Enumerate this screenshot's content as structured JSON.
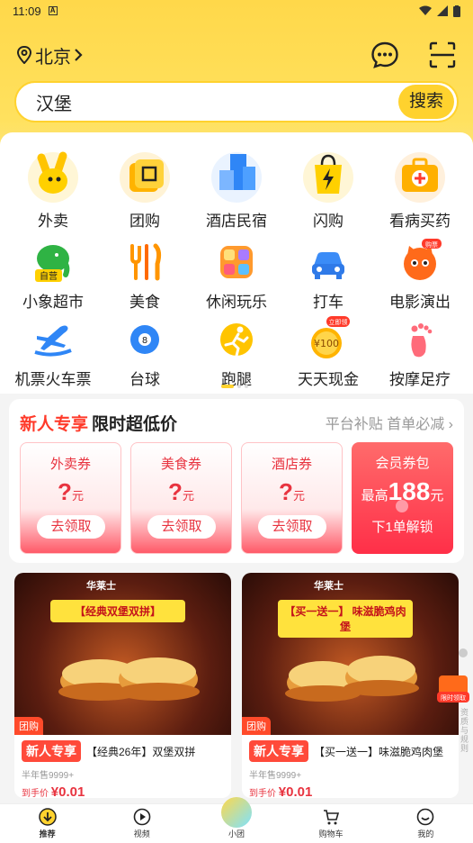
{
  "statusbar": {
    "time": "11:09",
    "badge": "A"
  },
  "header": {
    "city": "北京"
  },
  "search": {
    "value": "汉堡",
    "button": "搜索"
  },
  "categories": [
    {
      "label": "外卖",
      "icon": "rabbit-mascot-icon"
    },
    {
      "label": "团购",
      "icon": "coupon-ticket-icon"
    },
    {
      "label": "酒店民宿",
      "icon": "hotel-building-icon"
    },
    {
      "label": "闪购",
      "icon": "lightning-bag-icon"
    },
    {
      "label": "看病买药",
      "icon": "medicine-kit-icon"
    },
    {
      "label": "小象超市",
      "icon": "elephant-icon",
      "badge": "自营"
    },
    {
      "label": "美食",
      "icon": "fork-knife-icon"
    },
    {
      "label": "休闲玩乐",
      "icon": "leisure-grid-icon"
    },
    {
      "label": "打车",
      "icon": "car-icon"
    },
    {
      "label": "电影演出",
      "icon": "cat-mask-icon",
      "badge": "购票"
    },
    {
      "label": "机票火车票",
      "icon": "plane-icon"
    },
    {
      "label": "台球",
      "icon": "billiard-ball-icon"
    },
    {
      "label": "跑腿",
      "icon": "runner-icon"
    },
    {
      "label": "天天现金",
      "icon": "cash-coin-icon",
      "badge": "立即领",
      "coin_text": "¥100"
    },
    {
      "label": "按摩足疗",
      "icon": "foot-icon"
    }
  ],
  "newuser": {
    "title1": "新人专享",
    "title2": "限时超低价",
    "subtitle": "平台补贴 首单必减",
    "coupons": [
      {
        "name": "外卖券",
        "amount": "?",
        "unit": "元",
        "action": "去领取"
      },
      {
        "name": "美食券",
        "amount": "?",
        "unit": "元",
        "action": "去领取"
      },
      {
        "name": "酒店券",
        "amount": "?",
        "unit": "元",
        "action": "去领取"
      }
    ],
    "member": {
      "name": "会员券包",
      "prefix": "最高",
      "amount": "188",
      "unit": "元",
      "action": "下1单解锁"
    }
  },
  "deals": [
    {
      "tag": "团购",
      "brand": "华莱士",
      "promo": "【经典双堡双拼】",
      "badge": "新人专享",
      "title": "【经典26年】双堡双拼",
      "sold": "半年售9999+",
      "price_prefix": "到手价",
      "price": "¥0.01"
    },
    {
      "tag": "团购",
      "brand": "华莱士",
      "promo": "【买一送一】 味滋脆鸡肉堡",
      "badge": "新人专享",
      "title": "【买一送一】味滋脆鸡肉堡",
      "sold": "半年售9999+",
      "price_prefix": "到手价",
      "price": "¥0.01"
    }
  ],
  "floater": {
    "label": "限时领取",
    "side_text": "资质与规则"
  },
  "tabs": [
    {
      "label": "推荐",
      "icon": "home-recommend-icon",
      "active": true
    },
    {
      "label": "视频",
      "icon": "video-play-icon"
    },
    {
      "label": "小团",
      "icon": "mascot-icon"
    },
    {
      "label": "购物车",
      "icon": "cart-icon"
    },
    {
      "label": "我的",
      "icon": "profile-smile-icon"
    }
  ],
  "colors": {
    "brand_yellow": "#ffd22e",
    "accent_red": "#e8333f"
  }
}
